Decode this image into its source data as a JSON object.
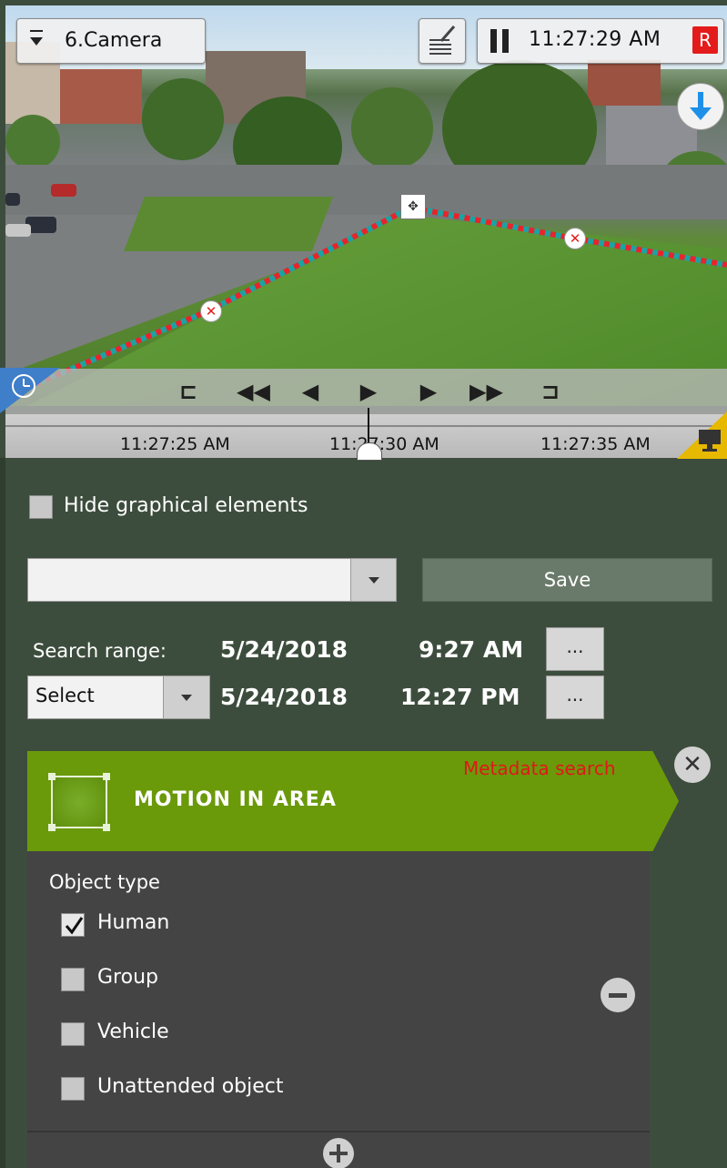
{
  "viewer": {
    "camera_name": "6.Camera",
    "clock_time": "11:27:29 AM",
    "record_badge": "R",
    "timeline_labels": [
      "11:27:25 AM",
      "11:27:30 AM",
      "11:27:35 AM"
    ],
    "controls": [
      "go-to-start",
      "previous-fast",
      "previous-frame",
      "play",
      "next-frame",
      "next-fast",
      "go-to-end"
    ],
    "icons": {
      "camera_dropdown": "chevron-down-icon",
      "notes": "note-pencil-icon",
      "pause": "pause-icon",
      "download": "download-arrow-icon",
      "clock": "clock-icon",
      "monitor": "monitor-icon"
    }
  },
  "panel": {
    "hide_graphics_label": "Hide graphical elements",
    "hide_graphics_checked": false,
    "preset_value": "",
    "save_label": "Save",
    "search_range_label": "Search range:",
    "range_start_date": "5/24/2018",
    "range_start_time": "9:27 AM",
    "range_end_date": "5/24/2018",
    "range_end_time": "12:27 PM",
    "ellipsis_label": "...",
    "period_select_value": "Select"
  },
  "card": {
    "title": "MOTION IN AREA",
    "metadata_label": "Metadata search",
    "close_label": "✕",
    "object_type_label": "Object type",
    "object_types": [
      {
        "label": "Human",
        "checked": true
      },
      {
        "label": "Group",
        "checked": false
      },
      {
        "label": "Vehicle",
        "checked": false
      },
      {
        "label": "Unattended object",
        "checked": false
      }
    ]
  },
  "colors": {
    "panel_bg": "#3d4d3d",
    "card_head": "#6a9a0a",
    "card_body": "#444444",
    "metadata_red": "#e01818",
    "record_red": "#e41b1b",
    "line_red": "#e8242a",
    "line_teal": "#1aa3a3"
  }
}
